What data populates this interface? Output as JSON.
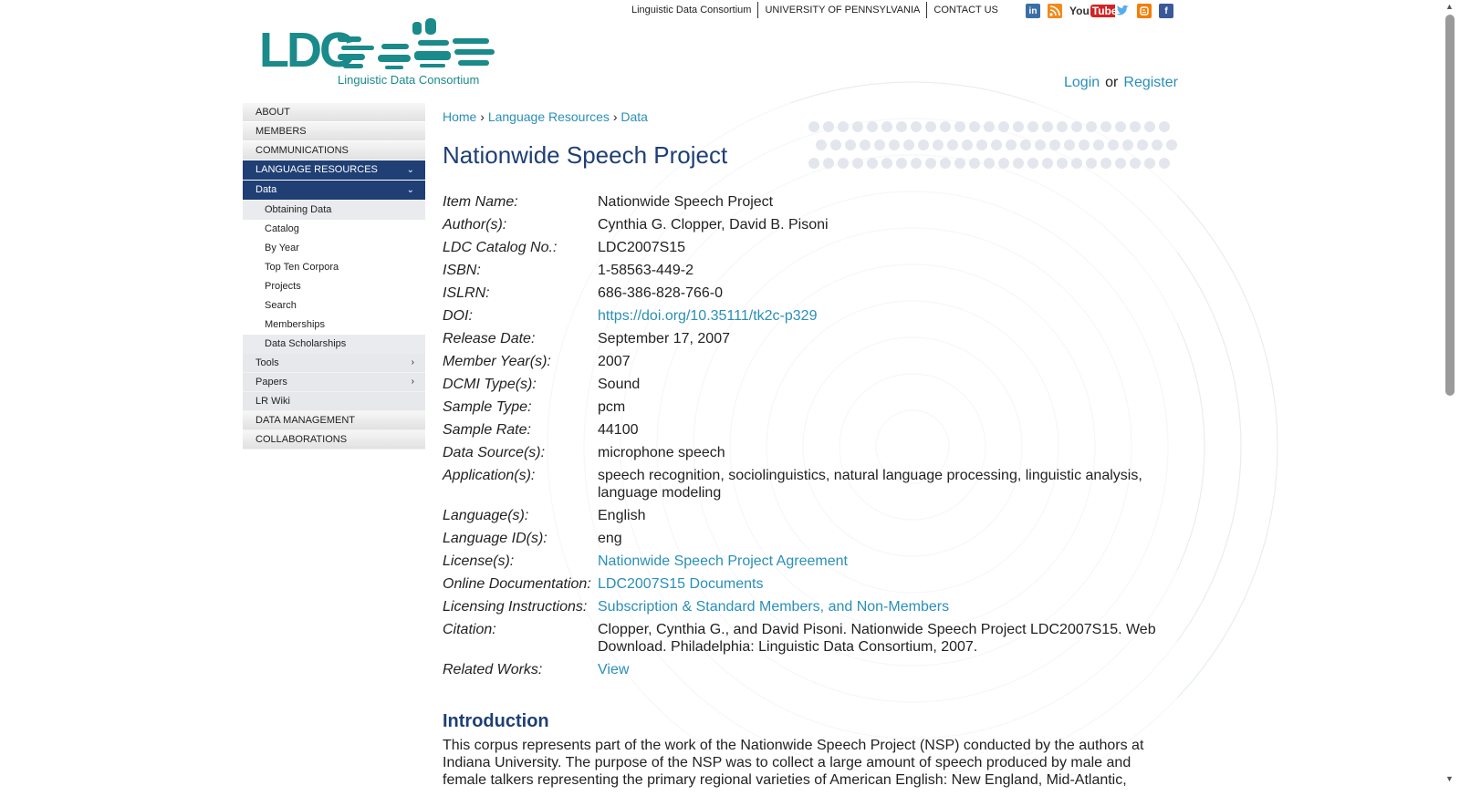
{
  "top_links": [
    "Linguistic Data Consortium",
    "UNIVERSITY OF PENNSYLVANIA",
    "CONTACT US"
  ],
  "social": {
    "youtube_text_a": "You",
    "youtube_text_b": "Tube",
    "linkedin": "in",
    "facebook": "f"
  },
  "logo": {
    "abbr": "LDC",
    "name": "Linguistic Data Consortium",
    "brand_color": "#1a8a8a"
  },
  "auth": {
    "login": "Login",
    "or": "or",
    "register": "Register"
  },
  "sidebar": {
    "items": [
      {
        "label": "ABOUT"
      },
      {
        "label": "MEMBERS"
      },
      {
        "label": "COMMUNICATIONS"
      },
      {
        "label": "LANGUAGE RESOURCES"
      },
      {
        "label": "Data"
      },
      {
        "label": "Obtaining Data"
      },
      {
        "label": "Catalog"
      },
      {
        "label": "By Year"
      },
      {
        "label": "Top Ten Corpora"
      },
      {
        "label": "Projects"
      },
      {
        "label": "Search"
      },
      {
        "label": "Memberships"
      },
      {
        "label": "Data Scholarships"
      },
      {
        "label": "Tools"
      },
      {
        "label": "Papers"
      },
      {
        "label": "LR Wiki"
      },
      {
        "label": "DATA MANAGEMENT"
      },
      {
        "label": "COLLABORATIONS"
      }
    ]
  },
  "breadcrumb": {
    "home": "Home",
    "sep": "›",
    "lr": "Language Resources",
    "data": "Data"
  },
  "page_title": "Nationwide Speech Project",
  "meta": [
    {
      "k": "Item Name:",
      "v": "Nationwide Speech Project"
    },
    {
      "k": "Author(s):",
      "v": "Cynthia G. Clopper, David B. Pisoni"
    },
    {
      "k": "LDC Catalog No.:",
      "v": "LDC2007S15"
    },
    {
      "k": "ISBN:",
      "v": "1-58563-449-2"
    },
    {
      "k": "ISLRN:",
      "v": "686-386-828-766-0"
    },
    {
      "k": "DOI:",
      "v": "https://doi.org/10.35111/tk2c-p329"
    },
    {
      "k": "Release Date:",
      "v": "September 17, 2007"
    },
    {
      "k": "Member Year(s):",
      "v": "2007"
    },
    {
      "k": "DCMI Type(s):",
      "v": "Sound"
    },
    {
      "k": "Sample Type:",
      "v": "pcm"
    },
    {
      "k": "Sample Rate:",
      "v": "44100"
    },
    {
      "k": "Data Source(s):",
      "v": "microphone speech"
    },
    {
      "k": "Application(s):",
      "v": "speech recognition, sociolinguistics, natural language processing, linguistic analysis, language modeling"
    },
    {
      "k": "Language(s):",
      "v": "English"
    },
    {
      "k": "Language ID(s):",
      "v": "eng"
    },
    {
      "k": "License(s):",
      "v": "Nationwide Speech Project Agreement"
    },
    {
      "k": "Online Documentation:",
      "v": "LDC2007S15 Documents"
    },
    {
      "k": "Licensing Instructions:",
      "v": "Subscription & Standard Members, and Non-Members"
    },
    {
      "k": "Citation:",
      "v": "Clopper, Cynthia G., and David Pisoni. Nationwide Speech Project LDC2007S15. Web Download. Philadelphia: Linguistic Data Consortium, 2007."
    },
    {
      "k": "Related Works:",
      "v": "View"
    }
  ],
  "intro_title": "Introduction",
  "intro_text": "This corpus represents part of the work of the Nationwide Speech Project (NSP) conducted by the authors at Indiana University. The purpose of the NSP was to collect a large amount of speech produced by male and female talkers representing the primary regional varieties of American English: New England, Mid-Atlantic,",
  "colors": {
    "link": "#2a8fb8",
    "nav_active": "#1f3f75",
    "title": "#1f3f75"
  }
}
